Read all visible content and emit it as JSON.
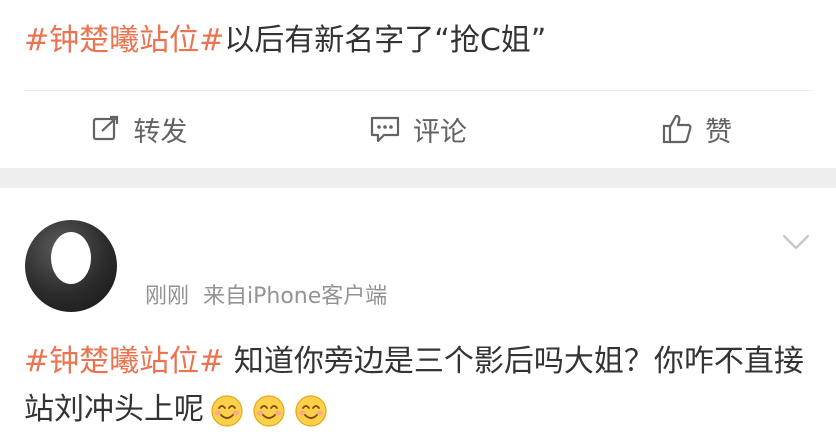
{
  "post1": {
    "topic": "#钟楚曦站位#",
    "text": "以后有新名字了“抢C姐”"
  },
  "actions": [
    {
      "icon": "share-icon",
      "label": "转发"
    },
    {
      "icon": "comment-icon",
      "label": "评论"
    },
    {
      "icon": "like-icon",
      "label": "赞"
    }
  ],
  "comment": {
    "time": "刚刚",
    "source": "来自iPhone客户端",
    "topic": "#钟楚曦站位#",
    "text": " 知道你旁边是三个影后吗大姐？你咋不直接站刘冲头上呢",
    "emoji": [
      "smile-emoji",
      "smile-emoji",
      "smile-emoji"
    ]
  },
  "colors": {
    "topic": "#eb7350",
    "text": "#333333",
    "muted": "#939393",
    "action": "#636363"
  }
}
